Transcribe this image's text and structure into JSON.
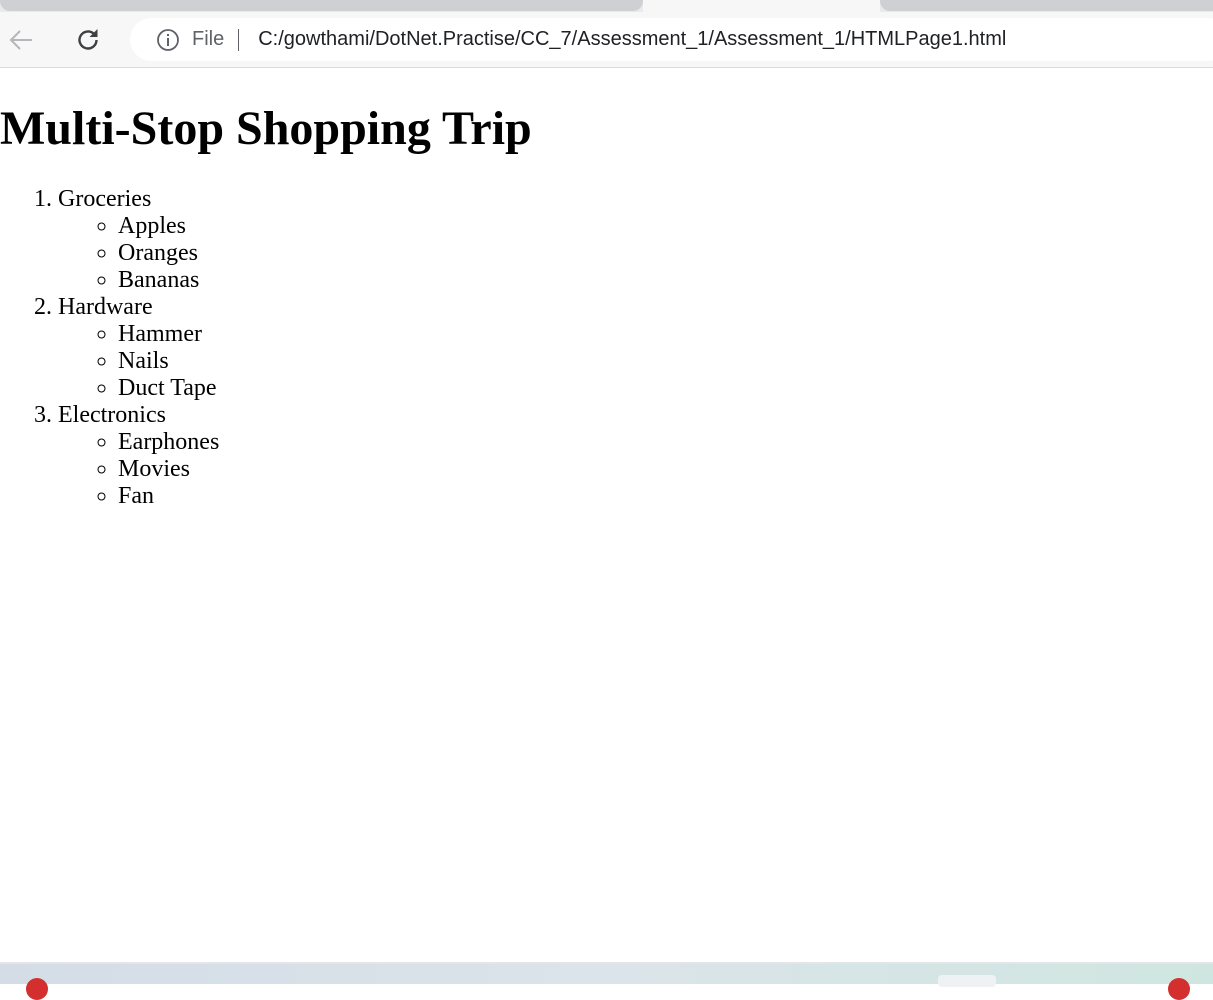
{
  "browser": {
    "address_bar": {
      "scheme_label": "File",
      "url": "C:/gowthami/DotNet.Practise/CC_7/Assessment_1/Assessment_1/HTMLPage1.html"
    },
    "icons": [
      "back-arrow-icon",
      "reload-icon",
      "info-icon"
    ]
  },
  "page": {
    "heading": "Multi-Stop Shopping Trip",
    "stops": [
      {
        "label": "Groceries",
        "items": [
          "Apples",
          "Oranges",
          "Bananas"
        ]
      },
      {
        "label": "Hardware",
        "items": [
          "Hammer",
          "Nails",
          "Duct Tape"
        ]
      },
      {
        "label": "Electronics",
        "items": [
          "Earphones",
          "Movies",
          "Fan"
        ]
      }
    ]
  }
}
